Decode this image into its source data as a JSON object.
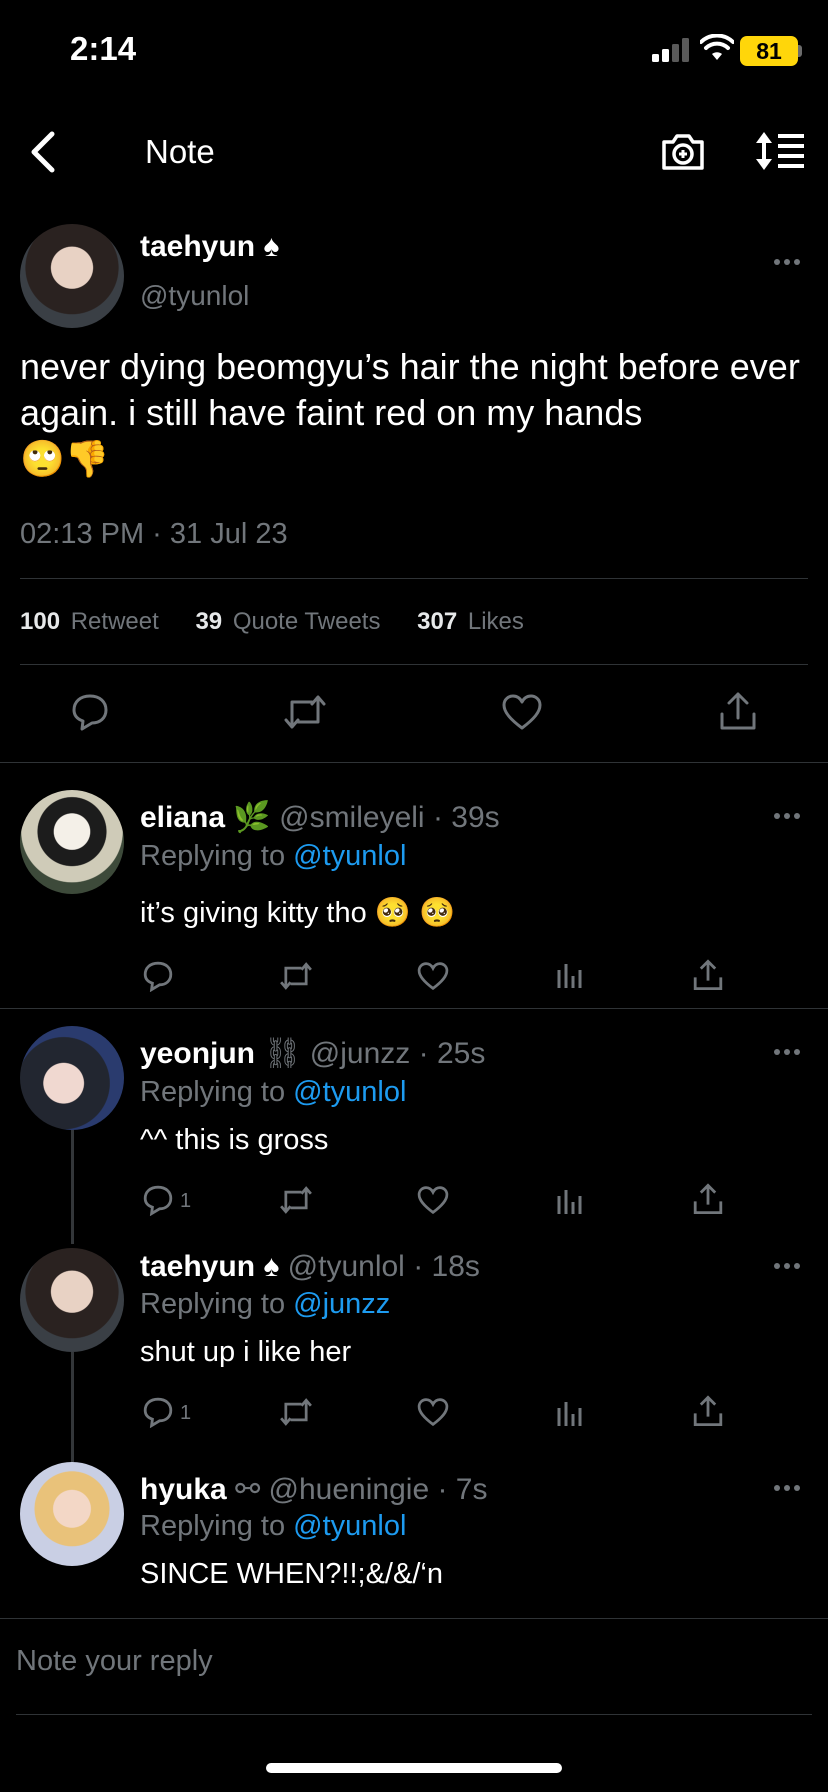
{
  "status_bar": {
    "time": "2:14",
    "battery": "81"
  },
  "header": {
    "title": "Note"
  },
  "main_tweet": {
    "name": "taehyun",
    "name_emoji": "♠",
    "handle": "@tyunlol",
    "text": "never dying beomgyu’s hair the night before ever again. i still have faint red on my hands",
    "emojis": "🙄👎",
    "timestamp": "02:13 PM · 31 Jul 23",
    "stats": {
      "retweets_count": "100",
      "retweets_label": "Retweet",
      "quotes_count": "39",
      "quotes_label": "Quote Tweets",
      "likes_count": "307",
      "likes_label": "Likes"
    }
  },
  "replies": [
    {
      "name": "eliana",
      "badge": "🌿",
      "handle": "@smileyeli",
      "age": "· 39s",
      "replying_prefix": "Replying to",
      "replying_to": "@tyunlol",
      "text": "it’s giving kitty tho 🥺 🥺",
      "reply_count": ""
    },
    {
      "name": "yeonjun",
      "badge": "⛓",
      "handle": "@junzz",
      "age": "· 25s",
      "replying_prefix": "Replying to",
      "replying_to": "@tyunlol",
      "text": "^^ this is gross",
      "reply_count": "1"
    },
    {
      "name": "taehyun",
      "badge": "♠",
      "handle": "@tyunlol",
      "age": "· 18s",
      "replying_prefix": "Replying to",
      "replying_to": "@junzz",
      "text": "shut up i like her",
      "reply_count": "1"
    },
    {
      "name": "hyuka",
      "badge": "⚯",
      "handle": "@hueningie",
      "age": "· 7s",
      "replying_prefix": "Replying to",
      "replying_to": "@tyunlol",
      "text": "SINCE WHEN?!!;&/&/‘n",
      "reply_count": ""
    }
  ],
  "composer": {
    "placeholder": "Note your reply"
  },
  "icons": {
    "back": "chevron-left-icon",
    "camera": "camera-plus-icon",
    "sort": "sort-list-icon",
    "reply": "comment-icon",
    "retweet": "retweet-icon",
    "like": "heart-icon",
    "views": "bar-chart-icon",
    "share": "share-icon",
    "more": "ellipsis-icon"
  },
  "colors": {
    "background": "#000000",
    "text": "#e7e9ea",
    "muted": "#71767b",
    "link": "#1d9bf0",
    "battery": "#ffd60a"
  }
}
